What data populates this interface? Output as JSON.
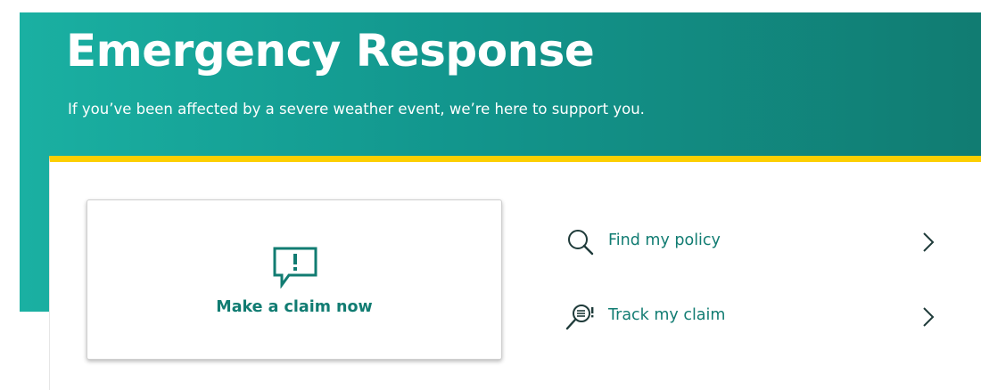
{
  "hero": {
    "title": "Emergency Response",
    "subtitle": "If you’ve been affected by a severe weather event, we’re here to support you."
  },
  "actions": {
    "claim_card": {
      "label": "Make a claim now",
      "icon": "alert-message-icon"
    },
    "links": [
      {
        "label": "Find my policy",
        "icon": "search-icon"
      },
      {
        "label": "Track my claim",
        "icon": "track-claim-icon"
      }
    ]
  },
  "colors": {
    "hero_gradient_start": "#1ab0a2",
    "hero_gradient_end": "#117c72",
    "accent_yellow": "#fccf00",
    "link_text": "#117c72"
  }
}
